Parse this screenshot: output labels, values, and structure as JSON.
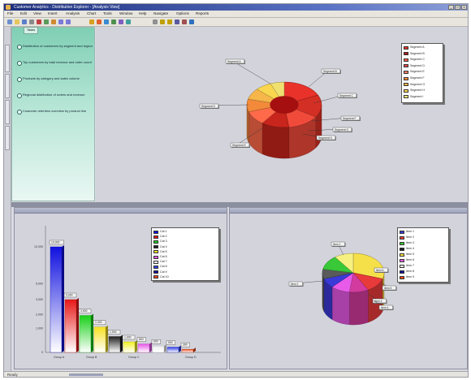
{
  "window": {
    "title": "Customer Analytics - Distribution Explorer - [Analysis View]",
    "controls": [
      "_",
      "□",
      "×"
    ]
  },
  "menu": [
    "File",
    "Edit",
    "View",
    "Insert",
    "Analysis",
    "Chart",
    "Tools",
    "Window",
    "Help",
    "Navigate",
    "Options",
    "Reports"
  ],
  "toolbar": {
    "icons": [
      "new-icon",
      "open-icon",
      "save-icon",
      "print-icon",
      "cut-icon",
      "copy-icon",
      "paste-icon",
      "undo-icon",
      "redo-icon",
      "chart-icon",
      "pie-icon",
      "bar-icon",
      "filter-icon",
      "zoom-icon",
      "refresh-icon",
      "settings-icon",
      "arrow-left-icon",
      "arrow-right-icon",
      "table-icon",
      "export-icon",
      "help-icon"
    ]
  },
  "left_tabs": [
    "Navigation",
    "Explorer",
    "Reports",
    "Analysis"
  ],
  "nav": {
    "tab_label": "Tasks",
    "items": [
      "Distribution of customers by segment and region",
      "Top customers by total revenue and order count",
      "Products by category and sales volume",
      "Regional distribution of orders and revenue",
      "Customer retention overview by product line"
    ]
  },
  "panes": {
    "top_title": "",
    "bottom_left_title": "",
    "bottom_right_title": ""
  },
  "status": {
    "text": "Ready"
  },
  "chart_data": [
    {
      "type": "pie",
      "title": "",
      "style": "3d-doughnut",
      "slices": [
        {
          "label": "Segment A",
          "value": 18,
          "color": "#e8322a"
        },
        {
          "label": "Segment B",
          "value": 16,
          "color": "#d42f24"
        },
        {
          "label": "Segment C",
          "value": 14,
          "color": "#f04a3a"
        },
        {
          "label": "Segment D",
          "value": 12,
          "color": "#c8251c"
        },
        {
          "label": "Segment E",
          "value": 10,
          "color": "#ff6a4a"
        },
        {
          "label": "Segment F",
          "value": 9,
          "color": "#f28a3a"
        },
        {
          "label": "Segment G",
          "value": 8,
          "color": "#f6b64a"
        },
        {
          "label": "Segment H",
          "value": 7,
          "color": "#f9d64e"
        },
        {
          "label": "Segment I",
          "value": 6,
          "color": "#f0e070"
        }
      ],
      "legend": {
        "position": "top-right",
        "entries": [
          {
            "label": "Segment A",
            "color": "#e8322a"
          },
          {
            "label": "Segment B",
            "color": "#b01818"
          },
          {
            "label": "Segment C",
            "color": "#ff5a4a"
          },
          {
            "label": "Segment D",
            "color": "#e04848"
          },
          {
            "label": "Segment E",
            "color": "#ff7a6a"
          },
          {
            "label": "Segment F",
            "color": "#f28a3a"
          },
          {
            "label": "Segment G",
            "color": "#f6b64a"
          },
          {
            "label": "Segment H",
            "color": "#ffd84a"
          },
          {
            "label": "Segment I",
            "color": "#fff27a"
          }
        ]
      },
      "callouts": [
        "Segment A",
        "Segment B",
        "Segment C",
        "Segment D",
        "Segment E",
        "Segment F",
        "Segment G",
        "Segment H"
      ]
    },
    {
      "type": "bar",
      "title": "",
      "categories": [
        "Cat 1",
        "Cat 2",
        "Cat 3",
        "Cat 4",
        "Cat 5",
        "Cat 6",
        "Cat 7",
        "Cat 8",
        "Cat 9",
        "Cat 10"
      ],
      "values": [
        10000,
        5000,
        3500,
        2400,
        1500,
        1000,
        800,
        600,
        500,
        300
      ],
      "colors": [
        "#1010e0",
        "#e81818",
        "#18d018",
        "#f6e020",
        "#202020",
        "#f2f020",
        "#e858e8",
        "#f0f0f0",
        "#3040e8",
        "#e84818"
      ],
      "ylim": [
        0,
        12000
      ],
      "yticks": [
        "10,000",
        "5,000",
        "3,000",
        "2,000",
        "1,000",
        "0"
      ],
      "xlabels": [
        "Group A",
        "Group B",
        "Group C",
        "Group D"
      ],
      "data_labels": [
        "10,000",
        "5,000",
        "3,500",
        "2,400",
        "1,500",
        "1,000",
        "800",
        "600",
        "500",
        "300"
      ],
      "legend": {
        "position": "top-right",
        "entries": [
          {
            "label": "Cat 1",
            "color": "#1010e0"
          },
          {
            "label": "Cat 2",
            "color": "#e81818"
          },
          {
            "label": "Cat 3",
            "color": "#18d018"
          },
          {
            "label": "Cat 4",
            "color": "#202020"
          },
          {
            "label": "Cat 5",
            "color": "#f6e020"
          },
          {
            "label": "Cat 6",
            "color": "#e858e8"
          },
          {
            "label": "Cat 7",
            "color": "#f0f0f0"
          },
          {
            "label": "Cat 8",
            "color": "#3040e8"
          },
          {
            "label": "Cat 9",
            "color": "#1010a0"
          },
          {
            "label": "Cat 10",
            "color": "#e84818"
          }
        ]
      }
    },
    {
      "type": "pie",
      "title": "",
      "style": "3d-multicolor",
      "slices": [
        {
          "label": "Item 1",
          "value": 30,
          "color": "#f6e04a"
        },
        {
          "label": "Item 2",
          "value": 12,
          "color": "#e83a3a"
        },
        {
          "label": "Item 3",
          "value": 10,
          "color": "#d33b9e"
        },
        {
          "label": "Item 4",
          "value": 10,
          "color": "#e85ae8"
        },
        {
          "label": "Item 5",
          "value": 8,
          "color": "#3a3ad8"
        },
        {
          "label": "Item 6",
          "value": 8,
          "color": "#5a5a5a"
        },
        {
          "label": "Item 7",
          "value": 12,
          "color": "#38c838"
        },
        {
          "label": "Item 8",
          "value": 10,
          "color": "#f6f080"
        }
      ],
      "legend": {
        "position": "top-right",
        "entries": [
          {
            "label": "Item 1",
            "color": "#3a3ad8"
          },
          {
            "label": "Item 2",
            "color": "#e83a3a"
          },
          {
            "label": "Item 3",
            "color": "#38c838"
          },
          {
            "label": "Item 4",
            "color": "#202020"
          },
          {
            "label": "Item 5",
            "color": "#f6e04a"
          },
          {
            "label": "Item 6",
            "color": "#e85ae8"
          },
          {
            "label": "Item 7",
            "color": "#f0f0f0"
          },
          {
            "label": "Item 8",
            "color": "#1010a0"
          },
          {
            "label": "Item 9",
            "color": "#e84818"
          }
        ]
      },
      "callouts": [
        "Item 1",
        "Item 2",
        "Item 3",
        "Item 4",
        "Item 5",
        "Item 6"
      ]
    }
  ]
}
